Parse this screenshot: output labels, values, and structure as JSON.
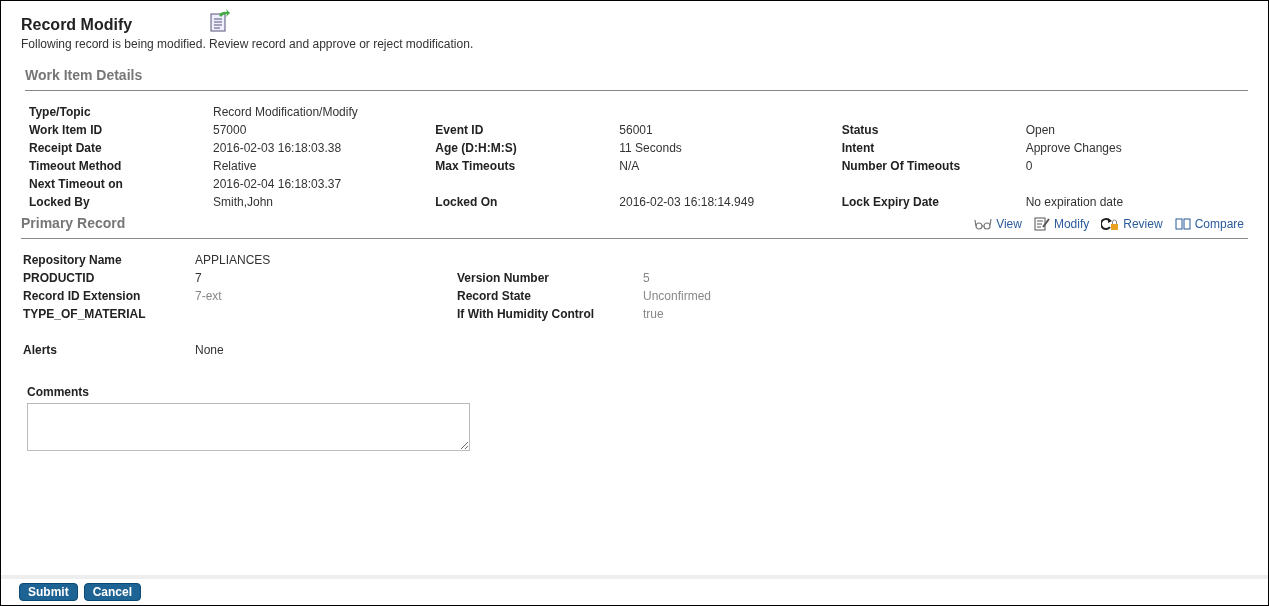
{
  "page": {
    "title": "Record Modify",
    "description": "Following record is being modified. Review record and approve or reject modification."
  },
  "work_item": {
    "heading": "Work Item Details",
    "rows": [
      [
        {
          "label": "Type/Topic",
          "value": "Record Modification/Modify"
        },
        null,
        null
      ],
      [
        {
          "label": "Work Item ID",
          "value": "57000"
        },
        {
          "label": "Event ID",
          "value": "56001"
        },
        {
          "label": "Status",
          "value": "Open"
        }
      ],
      [
        {
          "label": "Receipt Date",
          "value": "2016-02-03 16:18:03.38"
        },
        {
          "label": "Age (D:H:M:S)",
          "value": "11 Seconds"
        },
        {
          "label": "Intent",
          "value": "Approve Changes"
        }
      ],
      [
        {
          "label": "Timeout Method",
          "value": "Relative"
        },
        {
          "label": "Max Timeouts",
          "value": "N/A"
        },
        {
          "label": "Number Of Timeouts",
          "value": "0"
        }
      ],
      [
        {
          "label": "Next Timeout on",
          "value": "2016-02-04 16:18:03.37"
        },
        null,
        null
      ],
      [
        {
          "label": "Locked By",
          "value": "Smith,John"
        },
        {
          "label": "Locked On",
          "value": "2016-02-03 16:18:14.949"
        },
        {
          "label": "Lock Expiry Date",
          "value": "No expiration date"
        }
      ]
    ]
  },
  "primary_record": {
    "heading": "Primary Record",
    "actions": [
      {
        "kind": "view",
        "label": "View"
      },
      {
        "kind": "modify",
        "label": "Modify"
      },
      {
        "kind": "review",
        "label": "Review"
      },
      {
        "kind": "compare",
        "label": "Compare"
      }
    ],
    "rows": [
      [
        {
          "label": "Repository Name",
          "value": "APPLIANCES",
          "dimmed": false
        },
        null
      ],
      [
        {
          "label": "PRODUCTID",
          "value": "7",
          "dimmed": false
        },
        {
          "label": "Version Number",
          "value": "5",
          "dimmed": true
        }
      ],
      [
        {
          "label": "Record ID Extension",
          "value": "7-ext",
          "dimmed": true
        },
        {
          "label": "Record State",
          "value": "Unconfirmed",
          "dimmed": true
        }
      ],
      [
        {
          "label": "TYPE_OF_MATERIAL"
        },
        {
          "label": "If With Humidity Control",
          "value": "true",
          "dimmed": true
        }
      ]
    ],
    "alerts": {
      "label": "Alerts",
      "value": "None"
    }
  },
  "comments": {
    "label": "Comments"
  },
  "buttons": [
    "Submit",
    "Cancel"
  ]
}
